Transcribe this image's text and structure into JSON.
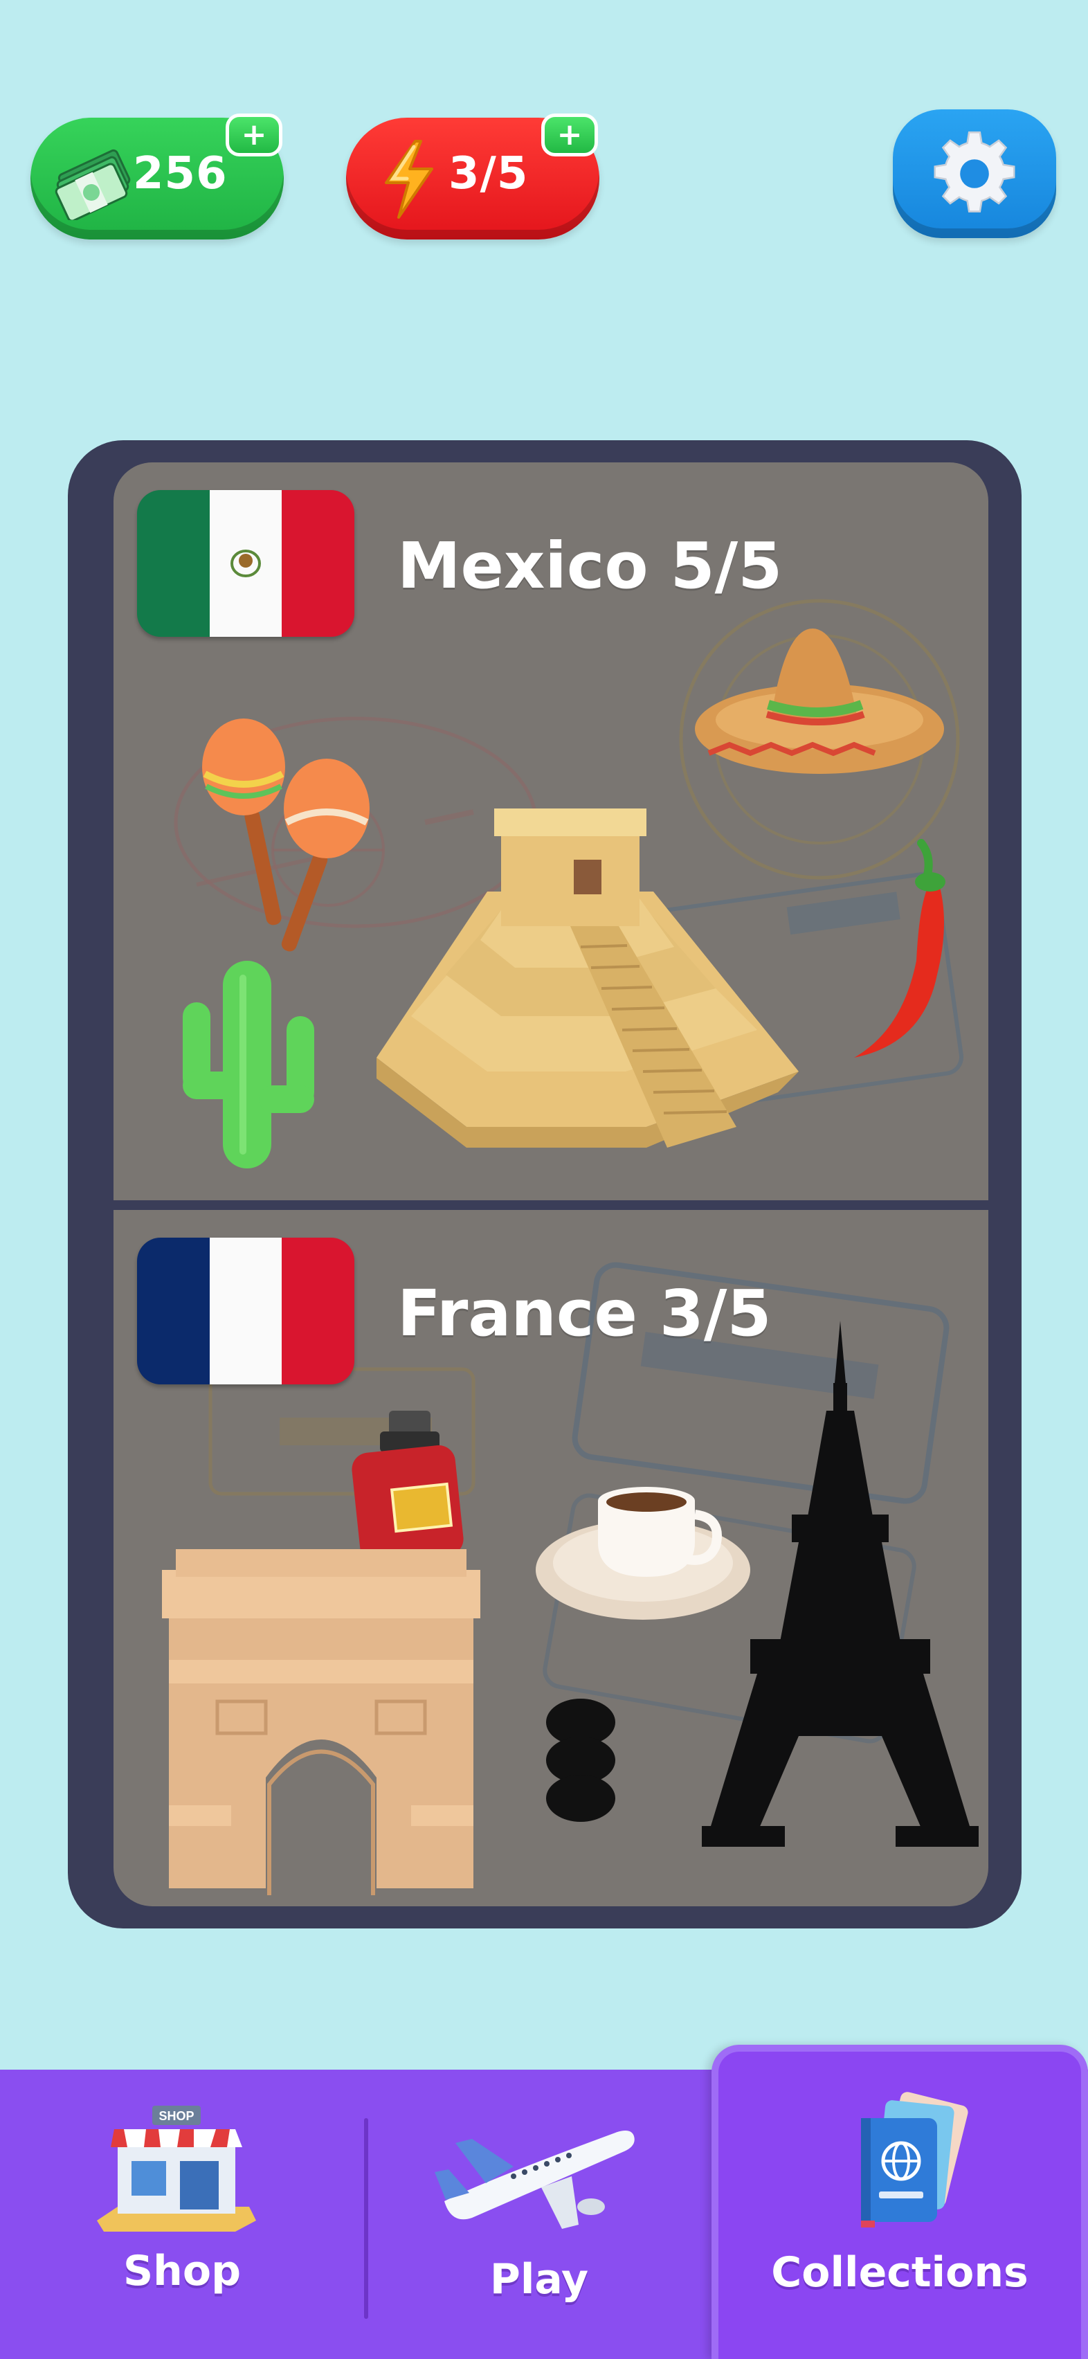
{
  "hud": {
    "cash": {
      "value": "256",
      "plus": "+",
      "icon": "cash-stack-icon"
    },
    "energy": {
      "value": "3/5",
      "plus": "+",
      "icon": "lightning-bolt-icon"
    },
    "settings": {
      "icon": "gear-icon"
    }
  },
  "collections": [
    {
      "country": "Mexico",
      "title": "Mexico 5/5",
      "progress": "5/5",
      "flag_icon": "mexico-flag-icon",
      "items": [
        "maracas-icon",
        "sombrero-icon",
        "pyramid-icon",
        "chili-pepper-icon",
        "cactus-icon"
      ]
    },
    {
      "country": "France",
      "title": "France 3/5",
      "progress": "3/5",
      "flag_icon": "france-flag-icon",
      "items": [
        "perfume-bottle-icon",
        "coffee-cup-icon",
        "arc-de-triomphe-icon",
        "macaron-silhouette-icon",
        "eiffel-tower-silhouette-icon"
      ]
    }
  ],
  "nav": {
    "shop": {
      "label": "Shop",
      "icon": "shop-icon",
      "sign": "SHOP"
    },
    "play": {
      "label": "Play",
      "icon": "airplane-icon"
    },
    "collections": {
      "label": "Collections",
      "icon": "passport-icon",
      "active": true
    }
  },
  "colors": {
    "background": "#bdecf0",
    "cash_pill": "#22b944",
    "energy_pill": "#e3141b",
    "settings_button": "#1685dc",
    "album_frame": "#3a3d58",
    "card": "#7a7672",
    "nav_bar": "#8a4ef0"
  }
}
